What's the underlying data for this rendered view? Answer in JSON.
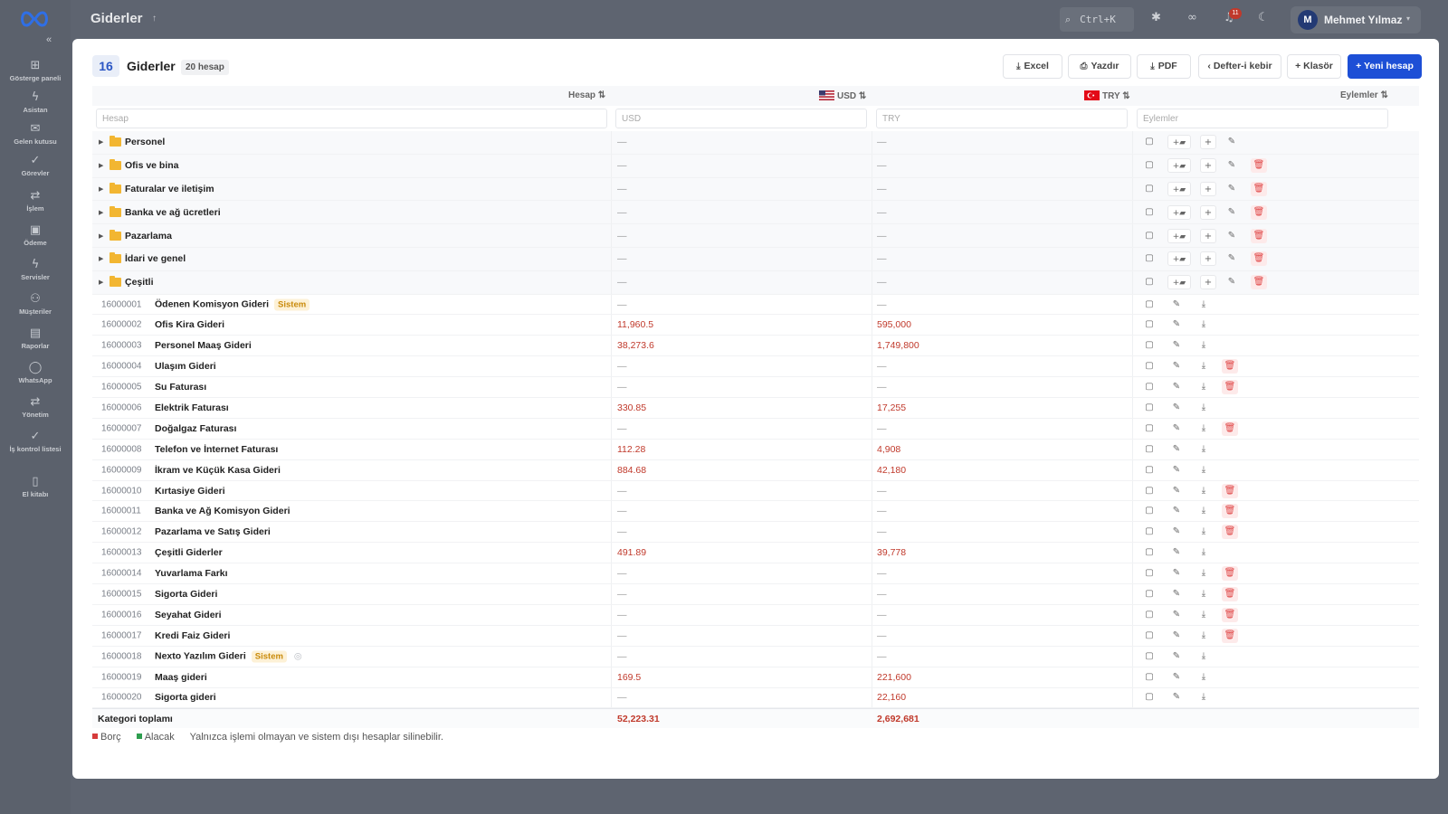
{
  "sidebar": {
    "collapse_glyph": "«",
    "items": [
      {
        "label": "Gösterge paneli",
        "icon": "dashboard-icon",
        "glyph": "⊞"
      },
      {
        "label": "Asistan",
        "icon": "bolt-icon",
        "glyph": "ϟ"
      },
      {
        "label": "Gelen kutusu",
        "icon": "mail-icon",
        "glyph": "✉"
      },
      {
        "label": "Görevler",
        "icon": "check-icon",
        "glyph": "✓"
      },
      {
        "label": "İşlem",
        "icon": "transfer-icon",
        "glyph": "⇄"
      },
      {
        "label": "Ödeme",
        "icon": "wallet-icon",
        "glyph": "▣"
      },
      {
        "label": "Servisler",
        "icon": "bolt-icon",
        "glyph": "ϟ"
      },
      {
        "label": "Müşteriler",
        "icon": "users-icon",
        "glyph": "⚇"
      },
      {
        "label": "Raporlar",
        "icon": "report-icon",
        "glyph": "▤"
      },
      {
        "label": "WhatsApp",
        "icon": "chat-icon",
        "glyph": "◯"
      },
      {
        "label": "Yönetim",
        "icon": "settings-icon",
        "glyph": "⇄"
      },
      {
        "label": "İş kontrol listesi",
        "icon": "checklist-icon",
        "glyph": "✓"
      },
      {
        "label": "El kitabı",
        "icon": "book-icon",
        "glyph": "▯"
      }
    ]
  },
  "topbar": {
    "title": "Giderler",
    "title_caret": "↑",
    "search_shortcut": "Ctrl+K",
    "notification_count": "11",
    "user_initial": "M",
    "user_name": "Mehmet Yılmaz",
    "user_caret": "▾"
  },
  "header": {
    "code": "16",
    "title": "Giderler",
    "count": "20 hesap",
    "buttons": {
      "excel": "Excel",
      "print": "Yazdır",
      "pdf": "PDF",
      "ledger": "‹ Defter-i kebir",
      "folder": "+ Klasör",
      "new_account": "+ Yeni hesap"
    }
  },
  "table": {
    "columns": {
      "account": "Hesap ⇅",
      "usd": "USD ⇅",
      "try": "TRY ⇅",
      "actions": "Eylemler ⇅"
    },
    "filters": {
      "account": "Hesap",
      "usd": "USD",
      "try": "TRY",
      "actions": "Eylemler"
    },
    "folders": [
      {
        "name": "Personel",
        "usd": "—",
        "try": "—",
        "deletable": false
      },
      {
        "name": "Ofis ve bina",
        "usd": "—",
        "try": "—",
        "deletable": true
      },
      {
        "name": "Faturalar ve iletişim",
        "usd": "—",
        "try": "—",
        "deletable": true
      },
      {
        "name": "Banka ve ağ ücretleri",
        "usd": "—",
        "try": "—",
        "deletable": true
      },
      {
        "name": "Pazarlama",
        "usd": "—",
        "try": "—",
        "deletable": true
      },
      {
        "name": "İdari ve genel",
        "usd": "—",
        "try": "—",
        "deletable": true
      },
      {
        "name": "Çeşitli",
        "usd": "—",
        "try": "—",
        "deletable": true
      }
    ],
    "accounts": [
      {
        "code": "16000001",
        "name": "Ödenen Komisyon Gideri",
        "badge": "Sistem",
        "hidden": false,
        "usd": "—",
        "try": "—",
        "deletable": false
      },
      {
        "code": "16000002",
        "name": "Ofis Kira Gideri",
        "badge": "",
        "hidden": false,
        "usd": "11,960.5",
        "try": "595,000",
        "deletable": false
      },
      {
        "code": "16000003",
        "name": "Personel Maaş Gideri",
        "badge": "",
        "hidden": false,
        "usd": "38,273.6",
        "try": "1,749,800",
        "deletable": false
      },
      {
        "code": "16000004",
        "name": "Ulaşım Gideri",
        "badge": "",
        "hidden": false,
        "usd": "—",
        "try": "—",
        "deletable": true
      },
      {
        "code": "16000005",
        "name": "Su Faturası",
        "badge": "",
        "hidden": false,
        "usd": "—",
        "try": "—",
        "deletable": true
      },
      {
        "code": "16000006",
        "name": "Elektrik Faturası",
        "badge": "",
        "hidden": false,
        "usd": "330.85",
        "try": "17,255",
        "deletable": false
      },
      {
        "code": "16000007",
        "name": "Doğalgaz Faturası",
        "badge": "",
        "hidden": false,
        "usd": "—",
        "try": "—",
        "deletable": true
      },
      {
        "code": "16000008",
        "name": "Telefon ve İnternet Faturası",
        "badge": "",
        "hidden": false,
        "usd": "112.28",
        "try": "4,908",
        "deletable": false
      },
      {
        "code": "16000009",
        "name": "İkram ve Küçük Kasa Gideri",
        "badge": "",
        "hidden": false,
        "usd": "884.68",
        "try": "42,180",
        "deletable": false
      },
      {
        "code": "16000010",
        "name": "Kırtasiye Gideri",
        "badge": "",
        "hidden": false,
        "usd": "—",
        "try": "—",
        "deletable": true
      },
      {
        "code": "16000011",
        "name": "Banka ve Ağ Komisyon Gideri",
        "badge": "",
        "hidden": false,
        "usd": "—",
        "try": "—",
        "deletable": true
      },
      {
        "code": "16000012",
        "name": "Pazarlama ve Satış Gideri",
        "badge": "",
        "hidden": false,
        "usd": "—",
        "try": "—",
        "deletable": true
      },
      {
        "code": "16000013",
        "name": "Çeşitli Giderler",
        "badge": "",
        "hidden": false,
        "usd": "491.89",
        "try": "39,778",
        "deletable": false
      },
      {
        "code": "16000014",
        "name": "Yuvarlama Farkı",
        "badge": "",
        "hidden": false,
        "usd": "—",
        "try": "—",
        "deletable": true
      },
      {
        "code": "16000015",
        "name": "Sigorta Gideri",
        "badge": "",
        "hidden": false,
        "usd": "—",
        "try": "—",
        "deletable": true
      },
      {
        "code": "16000016",
        "name": "Seyahat Gideri",
        "badge": "",
        "hidden": false,
        "usd": "—",
        "try": "—",
        "deletable": true
      },
      {
        "code": "16000017",
        "name": "Kredi Faiz Gideri",
        "badge": "",
        "hidden": false,
        "usd": "—",
        "try": "—",
        "deletable": true
      },
      {
        "code": "16000018",
        "name": "Nexto Yazılım Gideri",
        "badge": "Sistem",
        "hidden": true,
        "usd": "—",
        "try": "—",
        "deletable": false
      },
      {
        "code": "16000019",
        "name": "Maaş gideri",
        "badge": "",
        "hidden": false,
        "usd": "169.5",
        "try": "221,600",
        "deletable": false
      },
      {
        "code": "16000020",
        "name": "Sigorta gideri",
        "badge": "",
        "hidden": false,
        "usd": "—",
        "try": "22,160",
        "deletable": false
      }
    ],
    "total": {
      "label": "Kategori toplamı",
      "usd": "52,223.31",
      "try": "2,692,681"
    }
  },
  "legend": {
    "debit": "Borç",
    "credit": "Alacak",
    "note": "Yalnızca işlemi olmayan ve sistem dışı hesaplar silinebilir.",
    "debit_color": "#d63b3b",
    "credit_color": "#2e9e4f"
  },
  "colors": {
    "accent": "#1d4fd6",
    "negative": "#c0392b",
    "badge": "#c98a0a"
  }
}
